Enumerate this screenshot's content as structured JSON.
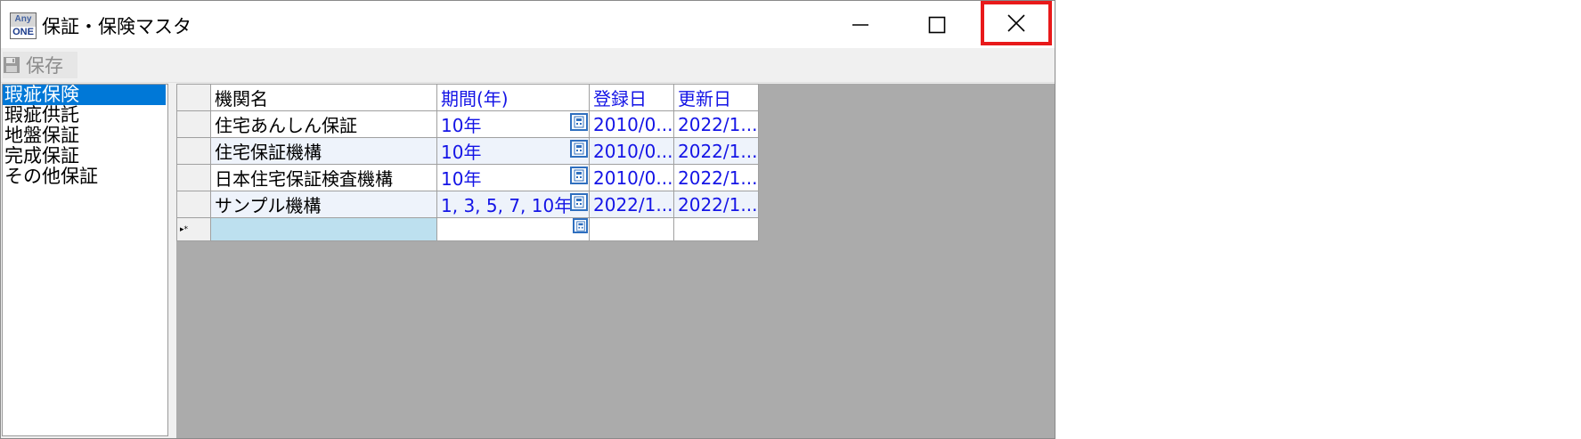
{
  "window": {
    "title": "保証・保険マスタ",
    "app_icon": {
      "line1": "Any",
      "line2": "ONE"
    },
    "controls": [
      "minimize-icon",
      "maximize-icon",
      "close-icon"
    ],
    "close_highlight_color": "#e8191a"
  },
  "toolbar": {
    "save_label": "保存",
    "save_icon": "floppy-disk-icon"
  },
  "sidebar": {
    "items": [
      {
        "label": "瑕疵保険",
        "selected": true
      },
      {
        "label": "瑕疵供託",
        "selected": false
      },
      {
        "label": "地盤保証",
        "selected": false
      },
      {
        "label": "完成保証",
        "selected": false
      },
      {
        "label": "その他保証",
        "selected": false
      }
    ]
  },
  "grid": {
    "columns": [
      "機関名",
      "期間(年)",
      "登録日",
      "更新日"
    ],
    "rows": [
      {
        "name": "住宅あんしん保証",
        "period": "10年",
        "registered": "2010/0...",
        "updated": "2022/1..."
      },
      {
        "name": "住宅保証機構",
        "period": "10年",
        "registered": "2010/0...",
        "updated": "2022/1..."
      },
      {
        "name": "日本住宅保証検査機構",
        "period": "10年",
        "registered": "2010/0...",
        "updated": "2022/1..."
      },
      {
        "name": "サンプル機構",
        "period": "1, 3, 5, 7, 10年",
        "registered": "2022/1...",
        "updated": "2022/1..."
      }
    ],
    "new_row_marker": "▸*",
    "accent_color": "#1414e6",
    "selection_color": "#0078d7"
  }
}
